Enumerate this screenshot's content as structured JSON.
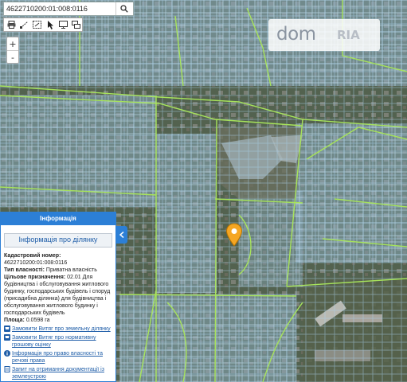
{
  "search": {
    "value": "4622710200:01:008:0116",
    "icon": "search-icon"
  },
  "toolbar": {
    "tools": [
      "print-icon",
      "measure-icon",
      "select-area-icon",
      "pointer-icon",
      "monitor-icon",
      "layers-icon"
    ]
  },
  "zoom": {
    "in_label": "+",
    "out_label": "-"
  },
  "logo": {
    "main": "dom",
    "sub": "RIA"
  },
  "colors": {
    "panel_accent": "#2c7fd6",
    "parcel_lines": "#a7e35b",
    "marker": "#f5a623",
    "link": "#1e5da8"
  },
  "panel": {
    "header": "Інформація",
    "title": "Інформація про ділянку",
    "cadastral_label": "Кадастровий номер:",
    "cadastral_value": "4622710200:01:008:0116",
    "ownership_label": "Тип власності:",
    "ownership_value": "Приватна власність",
    "purpose_label": "Цільове призначення:",
    "purpose_value": "02.01 Для будівництва і обслуговування житлового будинку, господарських будівель і споруд (присадибна ділянка) для будівництва і обслуговування житлового будинку і господарських будівель",
    "area_label": "Площа:",
    "area_value": "0.0598 га",
    "links": [
      {
        "icon": "cart-icon",
        "label": "Замовити Витяг про земельну ділянку"
      },
      {
        "icon": "cart-icon",
        "label": "Замовити Витяг про нормативну грошову оцінку"
      },
      {
        "icon": "info-icon",
        "label": "Інформація про право власності та речові права"
      },
      {
        "icon": "document-icon",
        "label": "Запит на отримання документації із землеустрою"
      }
    ],
    "collapse_icon": "chevron-left-icon"
  }
}
